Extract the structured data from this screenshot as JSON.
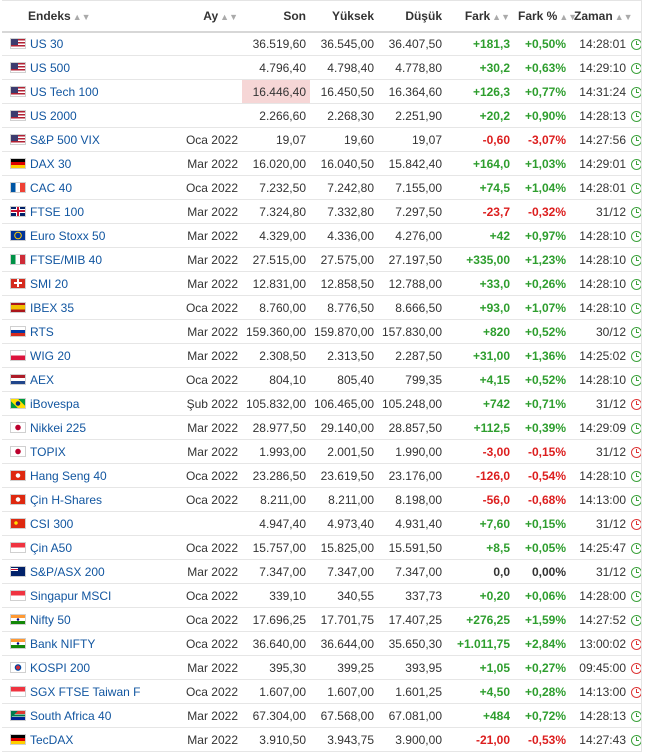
{
  "headers": {
    "name": "Endeks",
    "month": "Ay",
    "last": "Son",
    "high": "Yüksek",
    "low": "Düşük",
    "change": "Fark",
    "change_pct": "Fark %",
    "time": "Zaman"
  },
  "rows": [
    {
      "flag": "us",
      "name": "US 30",
      "month": "",
      "last": "36.519,60",
      "high": "36.545,00",
      "low": "36.407,50",
      "change": "+181,3",
      "pct": "+0,50%",
      "time": "14:28:01",
      "status": "open",
      "dir": "pos"
    },
    {
      "flag": "us",
      "name": "US 500",
      "month": "",
      "last": "4.796,40",
      "high": "4.798,40",
      "low": "4.778,80",
      "change": "+30,2",
      "pct": "+0,63%",
      "time": "14:29:10",
      "status": "open",
      "dir": "pos"
    },
    {
      "flag": "us",
      "name": "US Tech 100",
      "month": "",
      "last": "16.446,40",
      "high": "16.450,50",
      "low": "16.364,60",
      "change": "+126,3",
      "pct": "+0,77%",
      "time": "14:31:24",
      "status": "open",
      "dir": "pos",
      "highlight": true
    },
    {
      "flag": "us",
      "name": "US 2000",
      "month": "",
      "last": "2.266,60",
      "high": "2.268,30",
      "low": "2.251,90",
      "change": "+20,2",
      "pct": "+0,90%",
      "time": "14:28:13",
      "status": "open",
      "dir": "pos"
    },
    {
      "flag": "us",
      "name": "S&P 500 VIX",
      "month": "Oca 2022",
      "last": "19,07",
      "high": "19,60",
      "low": "19,07",
      "change": "-0,60",
      "pct": "-3,07%",
      "time": "14:27:56",
      "status": "open",
      "dir": "neg"
    },
    {
      "flag": "de",
      "name": "DAX 30",
      "month": "Mar 2022",
      "last": "16.020,00",
      "high": "16.040,50",
      "low": "15.842,40",
      "change": "+164,0",
      "pct": "+1,03%",
      "time": "14:29:01",
      "status": "open",
      "dir": "pos"
    },
    {
      "flag": "fr",
      "name": "CAC 40",
      "month": "Oca 2022",
      "last": "7.232,50",
      "high": "7.242,80",
      "low": "7.155,00",
      "change": "+74,5",
      "pct": "+1,04%",
      "time": "14:28:01",
      "status": "open",
      "dir": "pos"
    },
    {
      "flag": "gb",
      "name": "FTSE 100",
      "month": "Mar 2022",
      "last": "7.324,80",
      "high": "7.332,80",
      "low": "7.297,50",
      "change": "-23,7",
      "pct": "-0,32%",
      "time": "31/12",
      "status": "open",
      "dir": "neg"
    },
    {
      "flag": "eu",
      "name": "Euro Stoxx 50",
      "month": "Mar 2022",
      "last": "4.329,00",
      "high": "4.336,00",
      "low": "4.276,00",
      "change": "+42",
      "pct": "+0,97%",
      "time": "14:28:10",
      "status": "open",
      "dir": "pos"
    },
    {
      "flag": "it",
      "name": "FTSE/MIB 40",
      "month": "Mar 2022",
      "last": "27.515,00",
      "high": "27.575,00",
      "low": "27.197,50",
      "change": "+335,00",
      "pct": "+1,23%",
      "time": "14:28:10",
      "status": "open",
      "dir": "pos"
    },
    {
      "flag": "ch",
      "name": "SMI 20",
      "month": "Mar 2022",
      "last": "12.831,00",
      "high": "12.858,50",
      "low": "12.788,00",
      "change": "+33,0",
      "pct": "+0,26%",
      "time": "14:28:10",
      "status": "open",
      "dir": "pos"
    },
    {
      "flag": "es",
      "name": "IBEX 35",
      "month": "Oca 2022",
      "last": "8.760,00",
      "high": "8.776,50",
      "low": "8.666,50",
      "change": "+93,0",
      "pct": "+1,07%",
      "time": "14:28:10",
      "status": "open",
      "dir": "pos"
    },
    {
      "flag": "ru",
      "name": "RTS",
      "month": "Mar 2022",
      "last": "159.360,00",
      "high": "159.870,00",
      "low": "157.830,00",
      "change": "+820",
      "pct": "+0,52%",
      "time": "30/12",
      "status": "open",
      "dir": "pos"
    },
    {
      "flag": "pl",
      "name": "WIG 20",
      "month": "Mar 2022",
      "last": "2.308,50",
      "high": "2.313,50",
      "low": "2.287,50",
      "change": "+31,00",
      "pct": "+1,36%",
      "time": "14:25:02",
      "status": "open",
      "dir": "pos"
    },
    {
      "flag": "nl",
      "name": "AEX",
      "month": "Oca 2022",
      "last": "804,10",
      "high": "805,40",
      "low": "799,35",
      "change": "+4,15",
      "pct": "+0,52%",
      "time": "14:28:10",
      "status": "open",
      "dir": "pos"
    },
    {
      "flag": "br",
      "name": "iBovespa",
      "month": "Şub 2022",
      "last": "105.832,00",
      "high": "106.465,00",
      "low": "105.248,00",
      "change": "+742",
      "pct": "+0,71%",
      "time": "31/12",
      "status": "closed",
      "dir": "pos"
    },
    {
      "flag": "jp",
      "name": "Nikkei 225",
      "month": "Mar 2022",
      "last": "28.977,50",
      "high": "29.140,00",
      "low": "28.857,50",
      "change": "+112,5",
      "pct": "+0,39%",
      "time": "14:29:09",
      "status": "open",
      "dir": "pos"
    },
    {
      "flag": "jp",
      "name": "TOPIX",
      "month": "Mar 2022",
      "last": "1.993,00",
      "high": "2.001,50",
      "low": "1.990,00",
      "change": "-3,00",
      "pct": "-0,15%",
      "time": "31/12",
      "status": "closed",
      "dir": "neg"
    },
    {
      "flag": "hk",
      "name": "Hang Seng 40",
      "month": "Oca 2022",
      "last": "23.286,50",
      "high": "23.619,50",
      "low": "23.176,00",
      "change": "-126,0",
      "pct": "-0,54%",
      "time": "14:28:10",
      "status": "open",
      "dir": "neg"
    },
    {
      "flag": "hk",
      "name": "Çin H-Shares",
      "month": "Oca 2022",
      "last": "8.211,00",
      "high": "8.211,00",
      "low": "8.198,00",
      "change": "-56,0",
      "pct": "-0,68%",
      "time": "14:13:00",
      "status": "open",
      "dir": "neg"
    },
    {
      "flag": "cn",
      "name": "CSI 300",
      "month": "",
      "last": "4.947,40",
      "high": "4.973,40",
      "low": "4.931,40",
      "change": "+7,60",
      "pct": "+0,15%",
      "time": "31/12",
      "status": "closed",
      "dir": "pos"
    },
    {
      "flag": "sg",
      "name": "Çin A50",
      "month": "Oca 2022",
      "last": "15.757,00",
      "high": "15.825,00",
      "low": "15.591,50",
      "change": "+8,5",
      "pct": "+0,05%",
      "time": "14:25:47",
      "status": "open",
      "dir": "pos"
    },
    {
      "flag": "au",
      "name": "S&P/ASX 200",
      "month": "Mar 2022",
      "last": "7.347,00",
      "high": "7.347,00",
      "low": "7.347,00",
      "change": "0,0",
      "pct": "0,00%",
      "time": "31/12",
      "status": "open",
      "dir": "zero"
    },
    {
      "flag": "sg",
      "name": "Singapur MSCI",
      "month": "Oca 2022",
      "last": "339,10",
      "high": "340,55",
      "low": "337,73",
      "change": "+0,20",
      "pct": "+0,06%",
      "time": "14:28:00",
      "status": "open",
      "dir": "pos"
    },
    {
      "flag": "in",
      "name": "Nifty 50",
      "month": "Oca 2022",
      "last": "17.696,25",
      "high": "17.701,75",
      "low": "17.407,25",
      "change": "+276,25",
      "pct": "+1,59%",
      "time": "14:27:52",
      "status": "open",
      "dir": "pos"
    },
    {
      "flag": "in",
      "name": "Bank NIFTY",
      "month": "Oca 2022",
      "last": "36.640,00",
      "high": "36.644,00",
      "low": "35.650,30",
      "change": "+1.011,75",
      "pct": "+2,84%",
      "time": "13:00:02",
      "status": "closed",
      "dir": "pos"
    },
    {
      "flag": "kr",
      "name": "KOSPI 200",
      "month": "Mar 2022",
      "last": "395,30",
      "high": "399,25",
      "low": "393,95",
      "change": "+1,05",
      "pct": "+0,27%",
      "time": "09:45:00",
      "status": "closed",
      "dir": "pos"
    },
    {
      "flag": "sg",
      "name": "SGX FTSE Taiwan F",
      "month": "Oca 2022",
      "last": "1.607,00",
      "high": "1.607,00",
      "low": "1.601,25",
      "change": "+4,50",
      "pct": "+0,28%",
      "time": "14:13:00",
      "status": "closed",
      "dir": "pos"
    },
    {
      "flag": "za",
      "name": "South Africa 40",
      "month": "Mar 2022",
      "last": "67.304,00",
      "high": "67.568,00",
      "low": "67.081,00",
      "change": "+484",
      "pct": "+0,72%",
      "time": "14:28:13",
      "status": "open",
      "dir": "pos"
    },
    {
      "flag": "de",
      "name": "TecDAX",
      "month": "Mar 2022",
      "last": "3.910,50",
      "high": "3.943,75",
      "low": "3.900,00",
      "change": "-21,00",
      "pct": "-0,53%",
      "time": "14:27:43",
      "status": "open",
      "dir": "neg"
    }
  ],
  "colors": {
    "positive": "#2e9e2e",
    "negative": "#dc1e1e",
    "link": "#1256a0",
    "highlight": "#f6d6d6"
  }
}
